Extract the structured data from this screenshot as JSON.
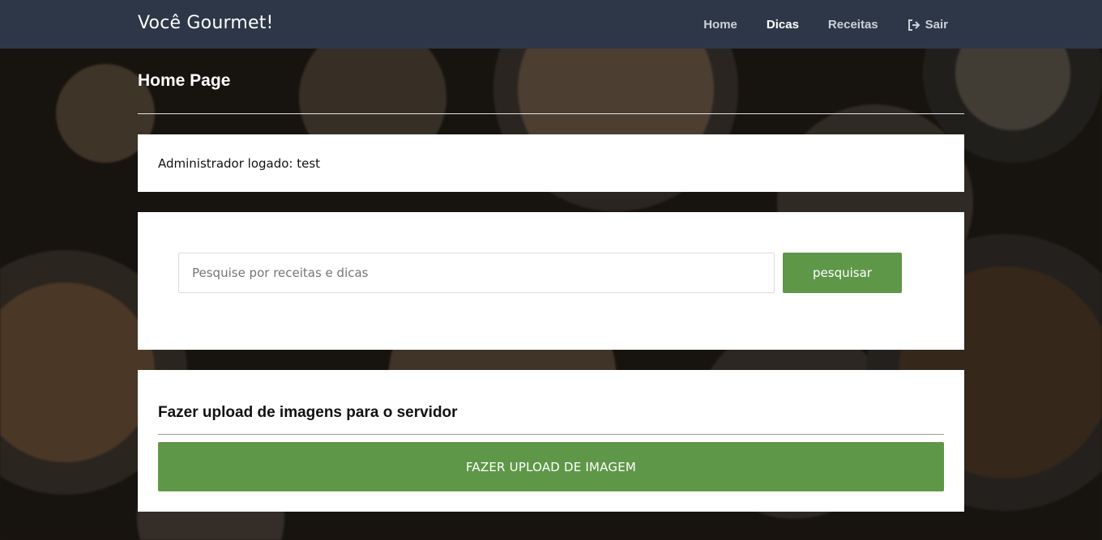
{
  "app": {
    "brand": "Você Gourmet!"
  },
  "nav": {
    "items": [
      {
        "label": "Home",
        "active": false
      },
      {
        "label": "Dicas",
        "active": true
      },
      {
        "label": "Receitas",
        "active": false
      }
    ],
    "logout_label": "Sair",
    "logout_icon": "sign-out-icon"
  },
  "page": {
    "title": "Home Page"
  },
  "admin": {
    "text": "Administrador logado: test"
  },
  "search": {
    "placeholder": "Pesquise por receitas e dicas",
    "value": "",
    "button_label": "pesquisar"
  },
  "upload": {
    "title": "Fazer upload de imagens para o servidor",
    "button_label": "FAZER UPLOAD DE IMAGEM"
  },
  "colors": {
    "navbar": "#2d3748",
    "accent_green": "#5f9748",
    "card": "#ffffff"
  }
}
